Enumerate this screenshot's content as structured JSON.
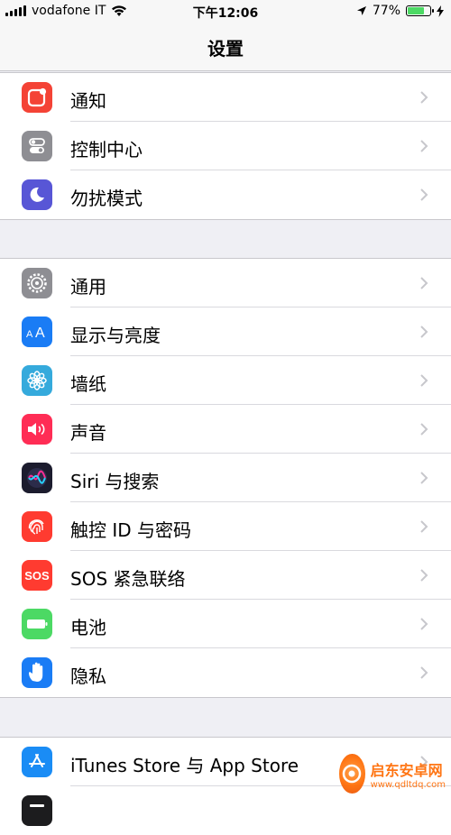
{
  "status": {
    "carrier": "vodafone IT",
    "time": "下午12:06",
    "battery_percent": "77%",
    "battery_level": 0.77
  },
  "nav": {
    "title": "设置"
  },
  "groups": [
    {
      "items": [
        {
          "label": "通知",
          "icon": "notifications-icon",
          "color": "#f44336"
        },
        {
          "label": "控制中心",
          "icon": "control-center-icon",
          "color": "#8e8e93"
        },
        {
          "label": "勿扰模式",
          "icon": "do-not-disturb-icon",
          "color": "#5856d6"
        }
      ]
    },
    {
      "items": [
        {
          "label": "通用",
          "icon": "general-gear-icon",
          "color": "#8e8e93"
        },
        {
          "label": "显示与亮度",
          "icon": "display-brightness-icon",
          "color": "#1a7cf5"
        },
        {
          "label": "墙纸",
          "icon": "wallpaper-icon",
          "color": "#35aadc"
        },
        {
          "label": "声音",
          "icon": "sounds-icon",
          "color": "#ff2d55"
        },
        {
          "label": "Siri 与搜索",
          "icon": "siri-icon",
          "color": "#1c1c2e"
        },
        {
          "label": "触控 ID 与密码",
          "icon": "touch-id-icon",
          "color": "#ff3b30"
        },
        {
          "label": "SOS 紧急联络",
          "icon": "sos-icon",
          "color": "#ff3b30",
          "icon_text": "SOS"
        },
        {
          "label": "电池",
          "icon": "battery-icon",
          "color": "#4cd964"
        },
        {
          "label": "隐私",
          "icon": "privacy-hand-icon",
          "color": "#1a7cf5"
        }
      ]
    },
    {
      "items": [
        {
          "label": "iTunes Store 与 App Store",
          "icon": "app-store-icon",
          "color": "#1a8cf5"
        },
        {
          "label": "",
          "icon": "wallet-icon",
          "color": "#1c1c1e"
        }
      ]
    }
  ],
  "watermark": {
    "name": "启东安卓网",
    "url": "www.qdltdq.com"
  }
}
